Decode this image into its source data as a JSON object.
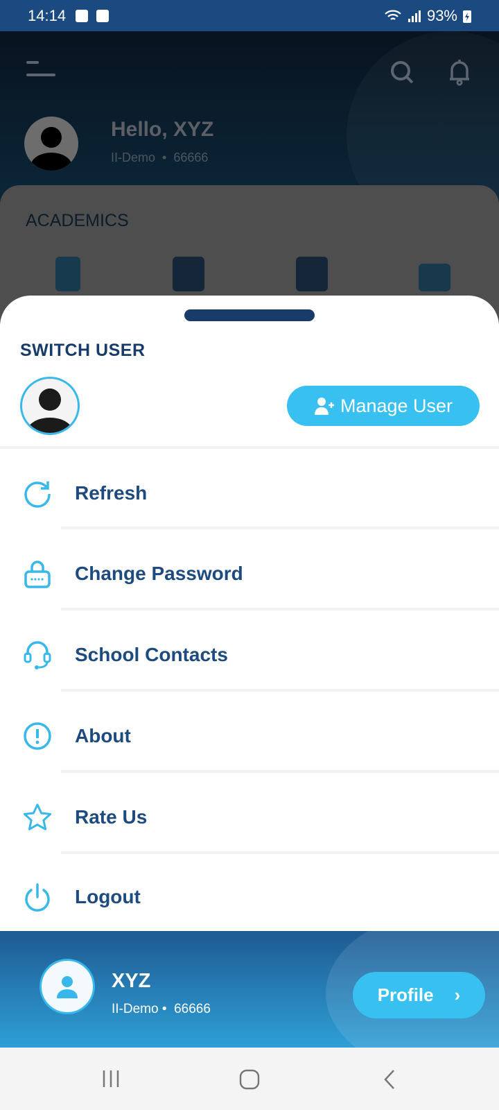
{
  "status_bar": {
    "time": "14:14",
    "battery": "93%",
    "icons": [
      "clock-icon",
      "image-icon",
      "wifi-icon",
      "signal-icon",
      "battery-charging-icon"
    ]
  },
  "header": {
    "greeting": "Hello, XYZ",
    "class": "II-Demo",
    "id": "66666",
    "section_title": "ACADEMICS"
  },
  "sheet": {
    "title": "SWITCH USER",
    "manage_label": "Manage User",
    "items": [
      {
        "label": "Refresh",
        "icon": "refresh-icon"
      },
      {
        "label": "Change Password",
        "icon": "lock-icon"
      },
      {
        "label": "School Contacts",
        "icon": "headset-icon"
      },
      {
        "label": "About",
        "icon": "info-alert-icon"
      },
      {
        "label": "Rate Us",
        "icon": "star-icon"
      },
      {
        "label": "Logout",
        "icon": "power-icon"
      }
    ]
  },
  "footer": {
    "name": "XYZ",
    "class": "II-Demo",
    "id": "66666",
    "profile_label": "Profile"
  },
  "colors": {
    "accent": "#38c0f0",
    "text": "#1d4a7f",
    "status_bar": "#1b4a80"
  }
}
